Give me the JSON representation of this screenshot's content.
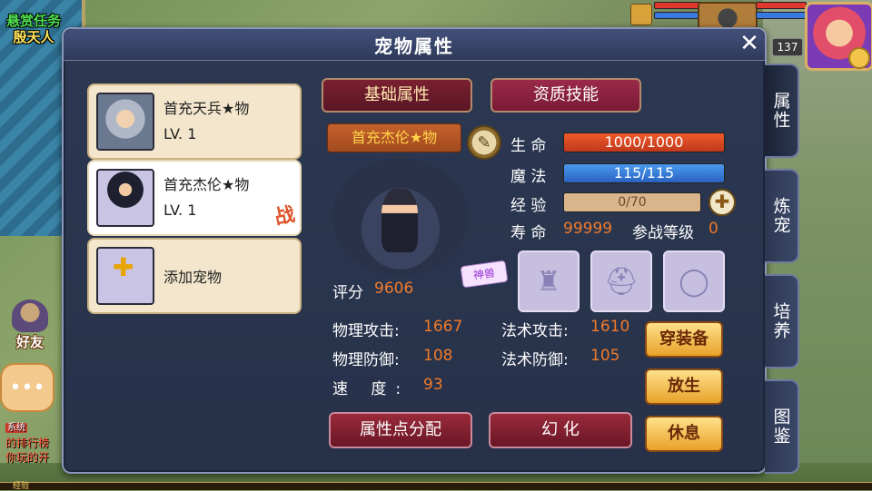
{
  "world": {
    "quest_title": "悬赏任务",
    "quest_target": "殷天人",
    "friend_label": "好友",
    "chat_badge": "系统",
    "chat_lines": [
      "的排行榜",
      "你玩的开"
    ],
    "exp_label": "经验",
    "player_level": "137"
  },
  "panel": {
    "title": "宠物属性",
    "close_symbol": "✕"
  },
  "side_tabs": [
    "属性",
    "炼宠",
    "培养",
    "图鉴"
  ],
  "pet_list": [
    {
      "name": "首充天兵★物",
      "level": "LV. 1"
    },
    {
      "name": "首充杰伦★物",
      "level": "LV. 1",
      "status": "战"
    },
    {
      "name": "添加宠物",
      "plus": "✚"
    }
  ],
  "tabs": {
    "basic": "基础属性",
    "aptitude": "资质技能"
  },
  "pet": {
    "name": "首充杰伦★物",
    "divine_badge": "神兽",
    "score_label": "评分",
    "score": "9606"
  },
  "vitals": {
    "hp_label": "生 命",
    "hp": "1000/1000",
    "hp_fraction": 1.0,
    "mp_label": "魔 法",
    "mp": "115/115",
    "mp_fraction": 1.0,
    "exp_label": "经 验",
    "exp": "0/70",
    "exp_fraction": 0.0,
    "life_label": "寿 命",
    "life": "99999",
    "battle_level_label": "参战等级",
    "battle_level": "0"
  },
  "attributes": [
    {
      "label": "物理攻击:",
      "value": "1667"
    },
    {
      "label": "物理防御:",
      "value": "108"
    },
    {
      "label": "速 度:",
      "value": "93"
    },
    {
      "label": "法术攻击:",
      "value": "1610"
    },
    {
      "label": "法术防御:",
      "value": "105"
    }
  ],
  "buttons": {
    "allocate": "属性点分配",
    "transform": "幻 化",
    "equip": "穿装备",
    "release": "放生",
    "rest": "休息",
    "plus": "✚"
  },
  "icons": {
    "rename": "pen-icon",
    "equip_slots": [
      "armor-icon",
      "helmet-icon",
      "collar-icon"
    ]
  },
  "colors": {
    "accent_orange": "#f07a2a",
    "panel_bg": "#2c3852",
    "hp_bar": "#f05a2a",
    "mp_bar": "#4a9af0"
  }
}
